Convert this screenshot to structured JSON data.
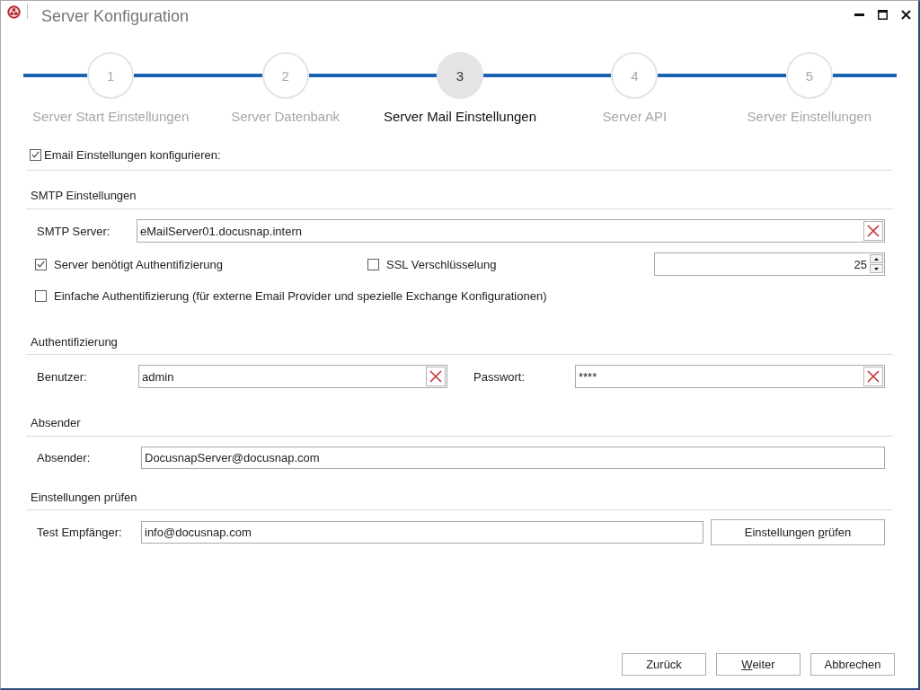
{
  "window": {
    "title": "Server Konfiguration"
  },
  "steps": [
    {
      "number": "1",
      "label": "Server Start Einstellungen",
      "selected": false
    },
    {
      "number": "2",
      "label": "Server Datenbank",
      "selected": false
    },
    {
      "number": "3",
      "label": "Server Mail Einstellungen",
      "selected": true
    },
    {
      "number": "4",
      "label": "Server API",
      "selected": false
    },
    {
      "number": "5",
      "label": "Server Einstellungen",
      "selected": false
    }
  ],
  "email_settings": {
    "label": "Email Einstellungen konfigurieren:",
    "checked": true
  },
  "smtp": {
    "heading": "SMTP Einstellungen",
    "server": {
      "label": "SMTP Server:",
      "value": "eMailServer01.docusnap.intern",
      "clearable": true
    },
    "auth_required": {
      "label": "Server benötigt Authentifizierung",
      "checked": true
    },
    "ssl": {
      "label": "SSL Verschlüsselung",
      "checked": false
    },
    "spinner": {
      "value": "25"
    },
    "simple_auth": {
      "label": "Einfache Authentifizierung (für externe Email Provider und spezielle Exchange Konfigurationen)",
      "checked": false
    }
  },
  "authentication": {
    "heading": "Authentifizierung",
    "user": {
      "label": "Benutzer:",
      "value": "admin",
      "clearable": true
    },
    "password": {
      "label": "Passwort:",
      "value": "****",
      "clearable": true
    }
  },
  "sender": {
    "heading": "Absender",
    "sender": {
      "label": "Absender:",
      "value": "DocusnapServer@docusnap.com",
      "clearable": false
    }
  },
  "test": {
    "heading": "Einstellungen prüfen",
    "recipient": {
      "label": "Test Empfänger:",
      "value": "info@docusnap.com",
      "clearable": false
    },
    "button": {
      "label_start": "Einstellungen ",
      "access_key": "p",
      "label_rest": "rüfen"
    }
  },
  "buttons": [
    {
      "label": "Zurück"
    },
    {
      "access_key": "W",
      "label_rest": "eiter"
    },
    {
      "label": "Abbrechen"
    }
  ]
}
